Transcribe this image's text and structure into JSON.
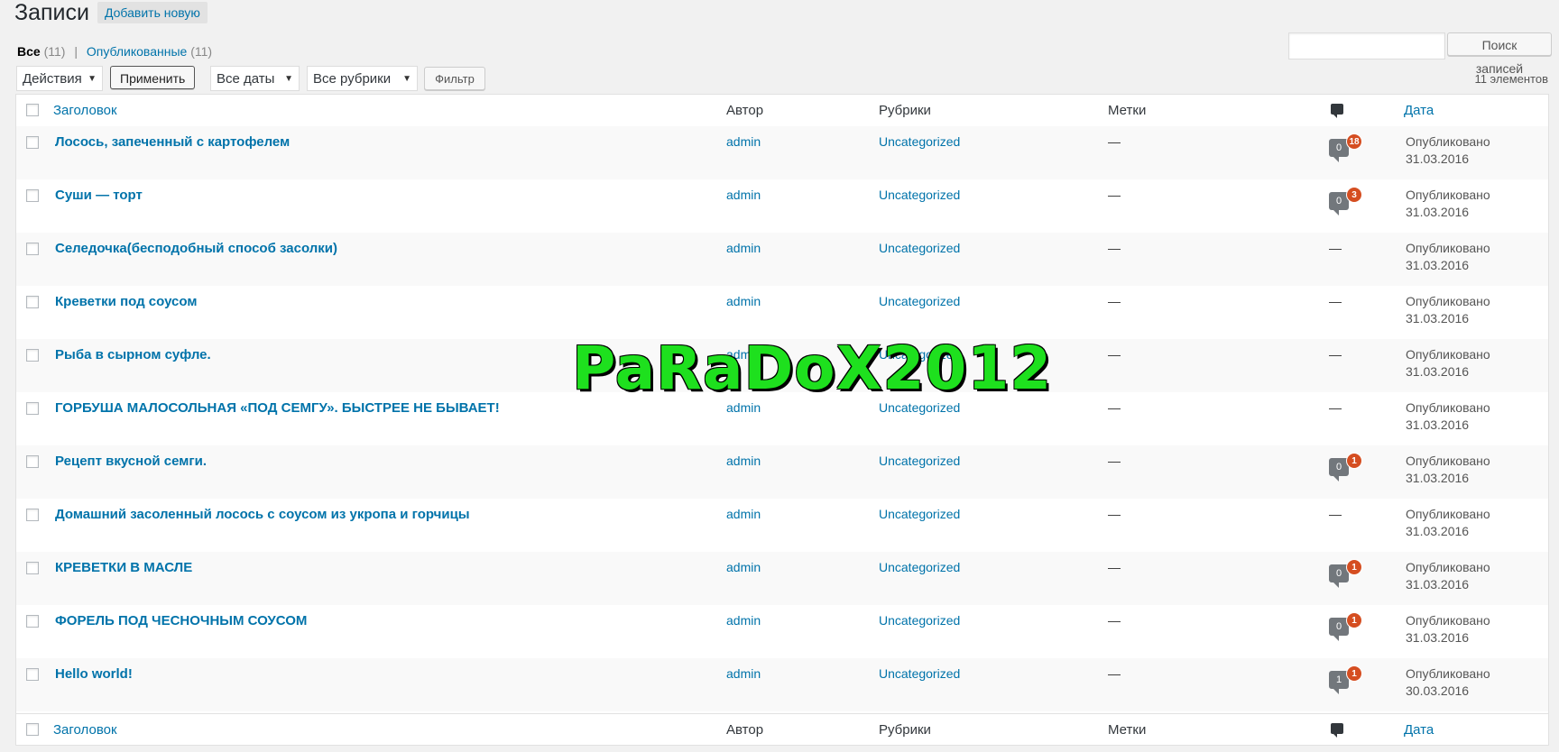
{
  "header": {
    "title": "Записи",
    "add_new": "Добавить новую"
  },
  "views": {
    "all_label": "Все",
    "all_count": "(11)",
    "separator": "|",
    "published_label": "Опубликованные",
    "published_count": "(11)"
  },
  "search": {
    "value": "",
    "button": "Поиск записей"
  },
  "bulk": {
    "actions_selected": "Действия",
    "apply": "Применить",
    "dates_selected": "Все даты",
    "cats_selected": "Все рубрики",
    "filter": "Фильтр",
    "items_count": "11 элементов"
  },
  "columns": {
    "title": "Заголовок",
    "author": "Автор",
    "categories": "Рубрики",
    "tags": "Метки",
    "comments_icon": "comment-icon",
    "date": "Дата"
  },
  "rows": [
    {
      "title": "Лосось, запеченный с картофелем",
      "author": "admin",
      "category": "Uncategorized",
      "tags": "—",
      "approved": "0",
      "pending": "18",
      "comments_dash": "",
      "status": "Опубликовано",
      "date": "31.03.2016"
    },
    {
      "title": "Суши — торт",
      "author": "admin",
      "category": "Uncategorized",
      "tags": "—",
      "approved": "0",
      "pending": "3",
      "comments_dash": "",
      "status": "Опубликовано",
      "date": "31.03.2016"
    },
    {
      "title": "Селедочка(бесподобный способ засолки)",
      "author": "admin",
      "category": "Uncategorized",
      "tags": "—",
      "approved": "",
      "pending": "",
      "comments_dash": "—",
      "status": "Опубликовано",
      "date": "31.03.2016"
    },
    {
      "title": "Креветки под соусом",
      "author": "admin",
      "category": "Uncategorized",
      "tags": "—",
      "approved": "",
      "pending": "",
      "comments_dash": "—",
      "status": "Опубликовано",
      "date": "31.03.2016"
    },
    {
      "title": "Рыба в сырном суфле.",
      "author": "admin",
      "category": "Uncategorized",
      "tags": "—",
      "approved": "",
      "pending": "",
      "comments_dash": "—",
      "status": "Опубликовано",
      "date": "31.03.2016"
    },
    {
      "title": "ГОРБУША МАЛОСОЛЬНАЯ «ПОД СЕМГУ». БЫСТРЕЕ НЕ БЫВАЕТ!",
      "author": "admin",
      "category": "Uncategorized",
      "tags": "—",
      "approved": "",
      "pending": "",
      "comments_dash": "—",
      "status": "Опубликовано",
      "date": "31.03.2016"
    },
    {
      "title": "Рецепт вкусной семги.",
      "author": "admin",
      "category": "Uncategorized",
      "tags": "—",
      "approved": "0",
      "pending": "1",
      "comments_dash": "",
      "status": "Опубликовано",
      "date": "31.03.2016"
    },
    {
      "title": "Домашний засоленный лосось с соусом из укропа и горчицы",
      "author": "admin",
      "category": "Uncategorized",
      "tags": "—",
      "approved": "",
      "pending": "",
      "comments_dash": "—",
      "status": "Опубликовано",
      "date": "31.03.2016"
    },
    {
      "title": "КРЕВЕТКИ В МАСЛЕ",
      "author": "admin",
      "category": "Uncategorized",
      "tags": "—",
      "approved": "0",
      "pending": "1",
      "comments_dash": "",
      "status": "Опубликовано",
      "date": "31.03.2016"
    },
    {
      "title": "ФОРЕЛЬ ПОД ЧЕСНОЧНЫМ СОУСОМ",
      "author": "admin",
      "category": "Uncategorized",
      "tags": "—",
      "approved": "0",
      "pending": "1",
      "comments_dash": "",
      "status": "Опубликовано",
      "date": "31.03.2016"
    },
    {
      "title": "Hello world!",
      "author": "admin",
      "category": "Uncategorized",
      "tags": "—",
      "approved": "1",
      "pending": "1",
      "comments_dash": "",
      "status": "Опубликовано",
      "date": "30.03.2016"
    }
  ],
  "watermark": "PaRaDoX2012",
  "colors": {
    "link": "#0073aa",
    "pending_badge": "#d54e21",
    "bubble": "#72777c",
    "watermark": "#1ee01e"
  }
}
